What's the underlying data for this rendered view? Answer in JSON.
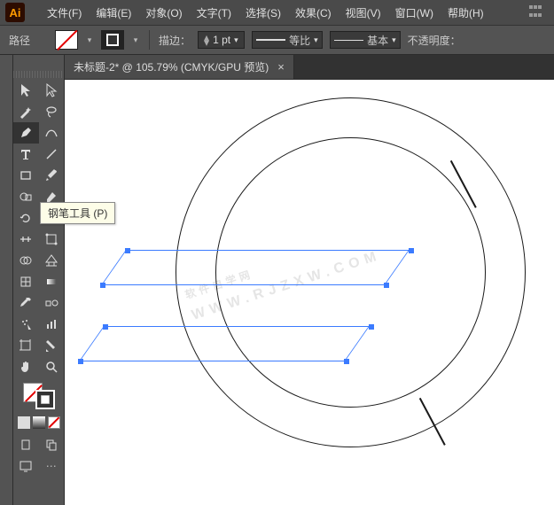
{
  "app_icon_text": "Ai",
  "menu": {
    "file": "文件(F)",
    "edit": "编辑(E)",
    "object": "对象(O)",
    "type": "文字(T)",
    "select": "选择(S)",
    "effect": "效果(C)",
    "view": "视图(V)",
    "window": "窗口(W)",
    "help": "帮助(H)"
  },
  "control": {
    "mode_label": "路径",
    "stroke_label": "描边：",
    "stroke_weight": "1 pt",
    "profile_label": "等比",
    "brush_label": "基本",
    "opacity_label": "不透明度："
  },
  "tab": {
    "title": "未标题-2* @ 105.79% (CMYK/GPU 预览)",
    "close": "×"
  },
  "tooltip": {
    "pen_tool": "钢笔工具 (P)"
  },
  "icons": {
    "dropdown": "▾",
    "up": "▴",
    "down": "▾"
  },
  "watermark": {
    "main": "软件自学网",
    "sub": "WWW.RJZXW.COM"
  }
}
